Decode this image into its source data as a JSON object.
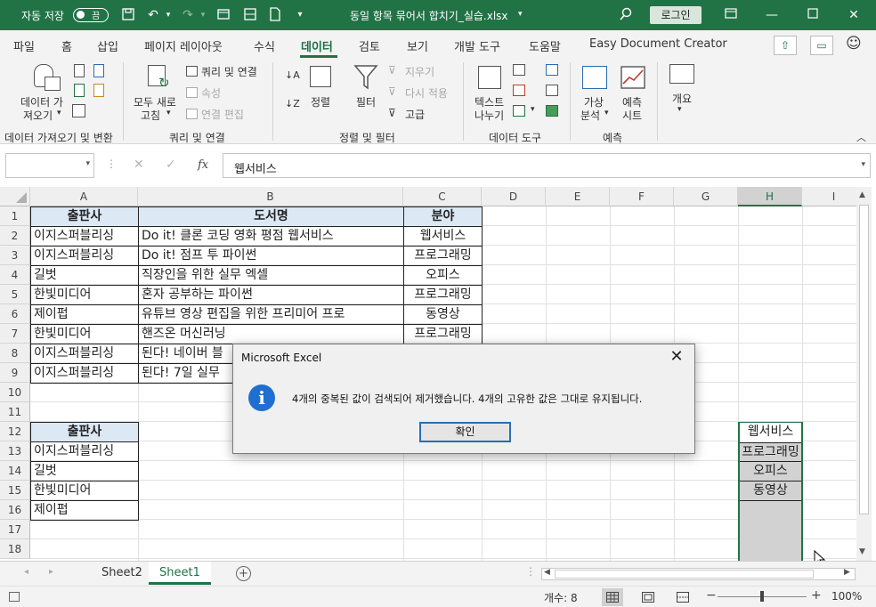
{
  "title_bar": {
    "autosave_label": "자동 저장",
    "autosave_state": "끔",
    "filename": "동일 항목 묶어서 합치기_실습.xlsx",
    "login_label": "로그인"
  },
  "menu_tabs": [
    "파일",
    "홈",
    "삽입",
    "페이지 레이아웃",
    "수식",
    "데이터",
    "검토",
    "보기",
    "개발 도구",
    "도움말",
    "Easy Document Creator"
  ],
  "active_tab": "데이터",
  "ribbon": {
    "get_data": {
      "button": [
        "데이터 가",
        "져오기"
      ],
      "group_label": "데이터 가져오기 및 변환"
    },
    "queries": {
      "refresh_all": [
        "모두 새로",
        "고침"
      ],
      "queries_connections": "쿼리 및 연결",
      "properties": "속성",
      "edit_links": "연결 편집",
      "group_label": "쿼리 및 연결"
    },
    "sort_filter": {
      "sort": "정렬",
      "filter": "필터",
      "clear": "지우기",
      "reapply": "다시 적용",
      "advanced": "고급",
      "group_label": "정렬 및 필터"
    },
    "data_tools": {
      "text_to_columns": [
        "텍스트",
        "나누기"
      ],
      "group_label": "데이터 도구"
    },
    "forecast": {
      "what_if": [
        "가상",
        "분석"
      ],
      "forecast_sheet": [
        "예측",
        "시트"
      ],
      "group_label": "예측"
    },
    "outline": {
      "label": "개요"
    }
  },
  "formula_bar": {
    "name_box": "",
    "fx_label": "fx",
    "value": "웹서비스"
  },
  "columns": [
    "A",
    "B",
    "C",
    "D",
    "E",
    "F",
    "G",
    "H",
    "I"
  ],
  "rows": [
    "1",
    "2",
    "3",
    "4",
    "5",
    "6",
    "7",
    "8",
    "9",
    "10",
    "11",
    "12",
    "13",
    "14",
    "15",
    "16",
    "17",
    "18"
  ],
  "table1": {
    "headers": [
      "출판사",
      "도서명",
      "분야"
    ],
    "rows": [
      [
        "이지스퍼블리싱",
        "Do it! 클론 코딩 영화 평점 웹서비스",
        "웹서비스"
      ],
      [
        "이지스퍼블리싱",
        "Do it! 점프 투 파이썬",
        "프로그래밍"
      ],
      [
        "길벗",
        "직장인을 위한 실무 엑셀",
        "오피스"
      ],
      [
        "한빛미디어",
        "혼자 공부하는 파이썬",
        "프로그래밍"
      ],
      [
        "제이펍",
        "유튜브 영상 편집을 위한 프리미어 프로",
        "동영상"
      ],
      [
        "한빛미디어",
        "핸즈온 머신러닝",
        "프로그래밍"
      ],
      [
        "이지스퍼블리싱",
        "된다! 네이버 블",
        ""
      ],
      [
        "이지스퍼블리싱",
        "된다! 7일 실무",
        ""
      ]
    ]
  },
  "table2": {
    "header": "출판사",
    "values": [
      "이지스퍼블리싱",
      "길벗",
      "한빛미디어",
      "제이펍"
    ]
  },
  "h_column": [
    "웹서비스",
    "프로그래밍",
    "오피스",
    "동영상"
  ],
  "sheets": [
    "Sheet2",
    "Sheet1"
  ],
  "active_sheet": "Sheet1",
  "status": {
    "count": "개수: 8",
    "zoom": "100%"
  },
  "dialog": {
    "title": "Microsoft Excel",
    "message": "4개의 중복된 값이 검색되어 제거했습니다. 4개의 고유한 값은 그대로 유지됩니다.",
    "ok": "확인",
    "icon": "info-icon"
  },
  "colors": {
    "excel_green": "#217346",
    "header_fill": "#dde8f5",
    "selection_gray": "#d2d2d2"
  }
}
